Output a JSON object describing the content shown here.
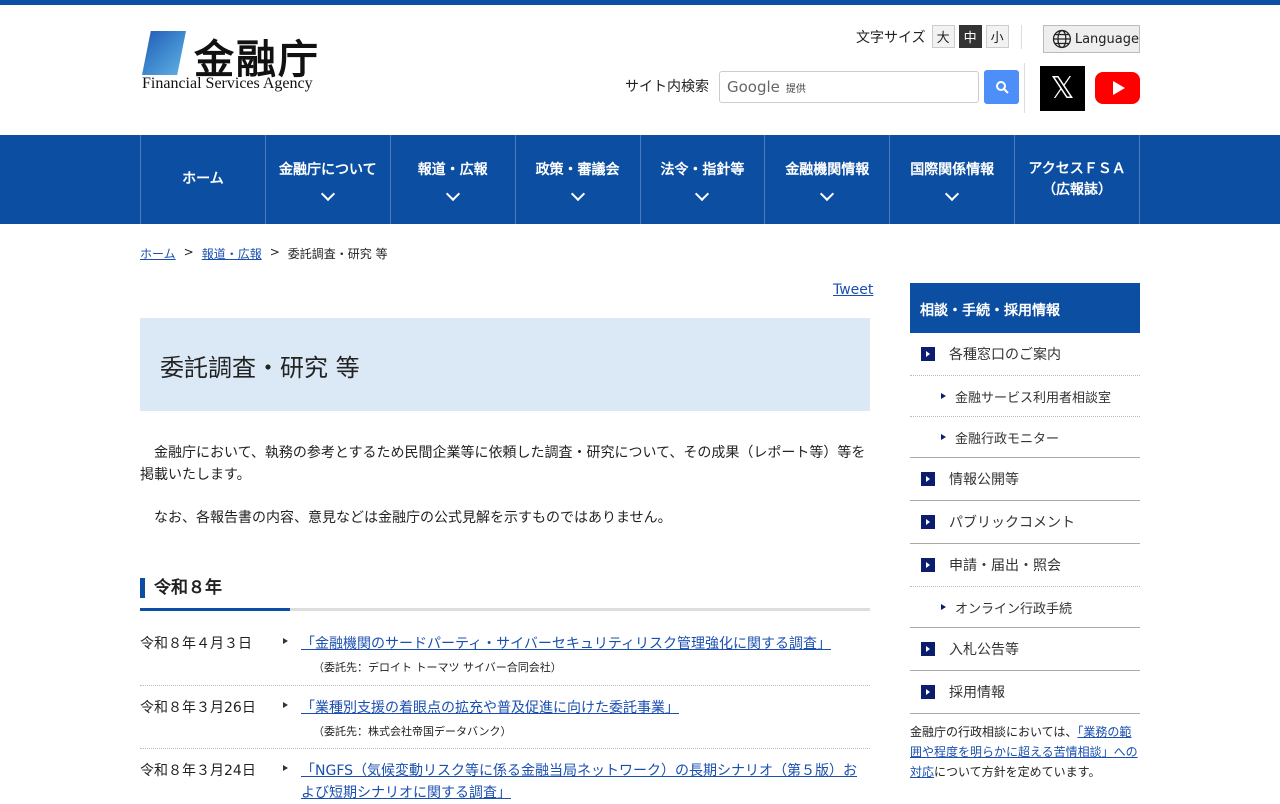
{
  "header": {
    "logo_jp": "金融庁",
    "logo_en": "Financial Services Agency",
    "font_size_label": "文字サイズ",
    "font_sizes": [
      "大",
      "中",
      "小"
    ],
    "language": "Language",
    "search_label": "サイト内検索",
    "search_google": "Google",
    "search_provided": "提供"
  },
  "nav": [
    "ホーム",
    "金融庁について",
    "報道・広報",
    "政策・審議会",
    "法令・指針等",
    "金融機関情報",
    "国際関係情報",
    "アクセスＦＳＡ",
    "（広報誌）"
  ],
  "breadcrumb": [
    "ホーム",
    "報道・広報",
    "委託調査・研究 等"
  ],
  "tweet": "Tweet",
  "title": "委託調査・研究 等",
  "intro1": "　金融庁において、執務の参考とするため民間企業等に依頼した調査・研究について、その成果（レポート等）等を掲載いたします。",
  "intro2": "　なお、各報告書の内容、意見などは金融庁の公式見解を示すものではありません。",
  "section": "令和８年",
  "items": [
    {
      "date": "令和８年４月３日",
      "title": "「金融機関のサードパーティ・サイバーセキュリティリスク管理強化に関する調査」",
      "sub": "（委託先：デロイト トーマツ サイバー合同会社）"
    },
    {
      "date": "令和８年３月26日",
      "title": "「業種別支援の着眼点の拡充や普及促進に向けた委託事業」",
      "sub": "（委託先：株式会社帝国データバンク）"
    },
    {
      "date": "令和８年３月24日",
      "title": "「NGFS（気候変動リスク等に係る金融当局ネットワーク）の長期シナリオ（第５版）および短期シナリオに関する調査」"
    }
  ],
  "sidebar": {
    "header": "相談・手続・採用情報",
    "i0": "各種窓口のご案内",
    "s0": "金融サービス利用者相談室",
    "s1": "金融行政モニター",
    "i1": "情報公開等",
    "i2": "パブリックコメント",
    "i3": "申請・届出・照会",
    "s2": "オンライン行政手続",
    "i4": "入札公告等",
    "i5": "採用情報",
    "note_pre": "金融庁の行政相談においては、",
    "note_link": "「業務の範囲や程度を明らかに超える苦情相談」への対応",
    "note_post": "について方針を定めています。"
  }
}
